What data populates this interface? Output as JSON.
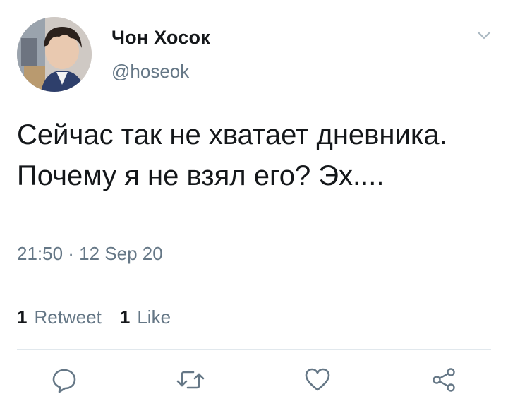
{
  "user": {
    "display_name": "Чон Хосок",
    "handle": "@hoseok"
  },
  "tweet": {
    "text": "Сейчас так не хватает дневника. Почему я не взял его? Эх....",
    "timestamp": "21:50 · 12 Sep 20"
  },
  "stats": {
    "retweets": {
      "count": "1",
      "label": "Retweet"
    },
    "likes": {
      "count": "1",
      "label": "Like"
    }
  },
  "actions": {
    "reply_icon": "reply-icon",
    "retweet_icon": "retweet-icon",
    "like_icon": "heart-icon",
    "share_icon": "share-icon"
  },
  "colors": {
    "text": "#14171a",
    "secondary": "#657786",
    "divider": "#e1e8ed",
    "icon": "#657786"
  }
}
